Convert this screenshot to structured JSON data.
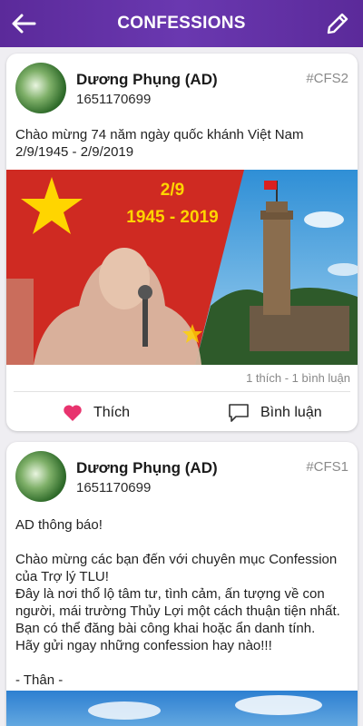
{
  "appbar": {
    "title": "CONFESSIONS",
    "back_icon": "arrow-left-icon",
    "edit_icon": "pencil-icon"
  },
  "posts": [
    {
      "author": "Dương Phụng (AD)",
      "user_id": "1651170699",
      "tag": "#CFS2",
      "text": "Chào mừng 74 năm ngày quốc khánh Việt Nam\n2/9/1945 - 2/9/2019",
      "image": {
        "date_text": "2/9",
        "years_text": "1945 - 2019"
      },
      "stats": "1 thích - 1 bình luận",
      "like_label": "Thích",
      "comment_label": "Bình luận"
    },
    {
      "author": "Dương Phụng (AD)",
      "user_id": "1651170699",
      "tag": "#CFS1",
      "text": "AD thông báo!\n\nChào mừng các bạn đến với chuyên mục Confession\ncủa Trợ lý TLU!\nĐây là nơi thổ lộ tâm tư, tình cảm, ấn tượng về con\nngười, mái trường Thủy Lợi một cách thuận tiện nhất.\nBạn có thể đăng bài công khai hoặc ẩn danh tính.\nHãy gửi ngay những confession hay nào!!!\n\n- Thân -"
    }
  ],
  "colors": {
    "appbar": "#5b2a9a",
    "like_heart": "#e8336e",
    "flag_red": "#d62828",
    "star_yellow": "#ffd500"
  }
}
